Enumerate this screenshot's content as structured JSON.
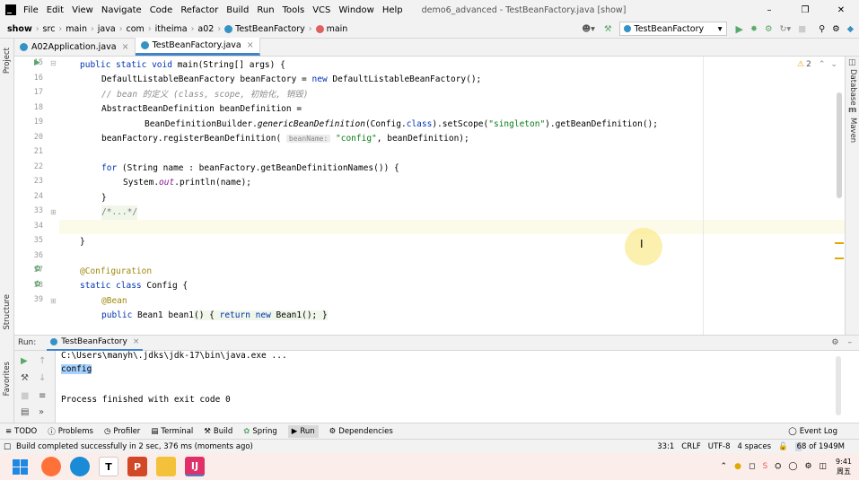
{
  "titlebar": {
    "menu": [
      "File",
      "Edit",
      "View",
      "Navigate",
      "Code",
      "Refactor",
      "Build",
      "Run",
      "Tools",
      "VCS",
      "Window",
      "Help"
    ],
    "title": "demo6_advanced - TestBeanFactory.java [show]"
  },
  "breadcrumb": [
    "show",
    "src",
    "main",
    "java",
    "com",
    "itheima",
    "a02",
    "TestBeanFactory",
    "main"
  ],
  "run_config": "TestBeanFactory",
  "tabs": [
    {
      "label": "A02Application.java",
      "active": false
    },
    {
      "label": "TestBeanFactory.java",
      "active": true
    }
  ],
  "left_strip": {
    "project": "Project",
    "structure": "Structure",
    "favorites": "Favorites"
  },
  "right_strip": {
    "database": "Database",
    "maven": "Maven"
  },
  "inspection": {
    "count": "2"
  },
  "line_numbers": [
    "15",
    "16",
    "17",
    "18",
    "19",
    "20",
    "21",
    "22",
    "23",
    "24",
    "33",
    "34",
    "35",
    "36",
    "37",
    "38",
    "39"
  ],
  "code": {
    "l15a": "public static void ",
    "l15b": "main",
    "l15c": "(String[] args) {",
    "l16a": "DefaultListableBeanFactory beanFactory = ",
    "l16b": "new ",
    "l16c": "DefaultListableBeanFactory();",
    "l17": "// bean 的定义 (class, scope, 初始化, 销毁)",
    "l18": "AbstractBeanDefinition beanDefinition =",
    "l19a": "BeanDefinitionBuilder.",
    "l19b": "genericBeanDefinition",
    "l19c": "(Config.",
    "l19d": "class",
    "l19e": ").setScope(",
    "l19f": "\"singleton\"",
    "l19g": ").getBeanDefinition();",
    "l20a": "beanFactory.registerBeanDefinition(",
    "l20hint": "beanName:",
    "l20b": "\"config\"",
    "l20c": ", beanDefinition);",
    "l22a": "for ",
    "l22b": "(String name : beanFactory.getBeanDefinitionNames()) {",
    "l23a": "System.",
    "l23b": "out",
    "l23c": ".println(name);",
    "l24": "}",
    "l25": "/*...*/",
    "l34": "}",
    "l36": "@Configuration",
    "l37a": "static class ",
    "l37b": "Config {",
    "l38": "@Bean",
    "l39a": "public ",
    "l39b": "Bean1 ",
    "l39c": "bean1",
    "l39d": "() { ",
    "l39e": "return new ",
    "l39f": "Bean1(); }"
  },
  "run": {
    "label": "Run:",
    "tab": "TestBeanFactory",
    "console": [
      "C:\\Users\\manyh\\.jdks\\jdk-17\\bin\\java.exe ...",
      "config",
      "",
      "Process finished with exit code 0"
    ]
  },
  "bottom_tabs": [
    "TODO",
    "Problems",
    "Profiler",
    "Terminal",
    "Build",
    "Spring",
    "Run",
    "Dependencies"
  ],
  "event_log": "Event Log",
  "status": {
    "message": "Build completed successfully in 2 sec, 376 ms (moments ago)",
    "position": "33:1",
    "line_sep": "CRLF",
    "encoding": "UTF-8",
    "indent": "4 spaces",
    "memory": "68 of 1949M"
  },
  "taskbar": {
    "clock_time": "9:41",
    "clock_day": "周五"
  },
  "colors": {
    "accent": "#4083c9",
    "keyword": "#0033b3",
    "string": "#067d17",
    "annotation": "#9e880d",
    "comment": "#8c8c8c",
    "run_green": "#59a869"
  }
}
